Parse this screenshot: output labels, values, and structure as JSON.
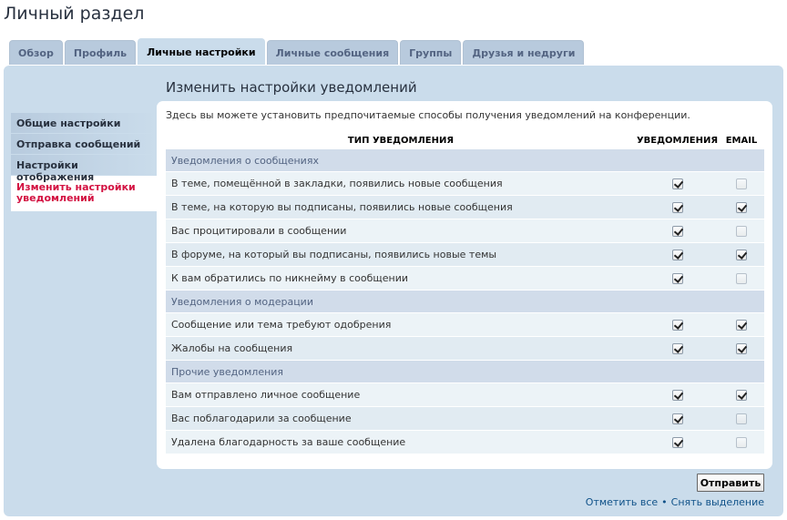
{
  "page_title": "Личный раздел",
  "tabs": [
    {
      "label": "Обзор",
      "active": false
    },
    {
      "label": "Профиль",
      "active": false
    },
    {
      "label": "Личные настройки",
      "active": true
    },
    {
      "label": "Личные сообщения",
      "active": false
    },
    {
      "label": "Группы",
      "active": false
    },
    {
      "label": "Друзья и недруги",
      "active": false
    }
  ],
  "sidebar": {
    "items": [
      {
        "label": "Общие настройки",
        "active": false
      },
      {
        "label": "Отправка сообщений",
        "active": false
      },
      {
        "label": "Настройки отображения",
        "active": false
      },
      {
        "label": "Изменить настройки уведомлений",
        "active": true
      }
    ]
  },
  "main": {
    "heading": "Изменить настройки уведомлений",
    "intro": "Здесь вы можете установить предпочитаемые способы получения уведомлений на конференции.",
    "table": {
      "headers": {
        "type": "ТИП УВЕДОМЛЕНИЯ",
        "notifications": "УВЕДОМЛЕНИЯ",
        "email": "EMAIL"
      },
      "groups": [
        {
          "title": "Уведомления о сообщениях",
          "items": [
            {
              "label": "В теме, помещённой в закладки, появились новые сообщения",
              "notif": true,
              "email": false
            },
            {
              "label": "В теме, на которую вы подписаны, появились новые сообщения",
              "notif": true,
              "email": true
            },
            {
              "label": "Вас процитировали в сообщении",
              "notif": true,
              "email": false
            },
            {
              "label": "В форуме, на который вы подписаны, появились новые темы",
              "notif": true,
              "email": true
            },
            {
              "label": "К вам обратились по никнейму в сообщении",
              "notif": true,
              "email": false
            }
          ]
        },
        {
          "title": "Уведомления о модерации",
          "items": [
            {
              "label": "Сообщение или тема требуют одобрения",
              "notif": true,
              "email": true
            },
            {
              "label": "Жалобы на сообщения",
              "notif": true,
              "email": true
            }
          ]
        },
        {
          "title": "Прочие уведомления",
          "items": [
            {
              "label": "Вам отправлено личное сообщение",
              "notif": true,
              "email": true
            },
            {
              "label": "Вас поблагодарили за сообщение",
              "notif": true,
              "email": false
            },
            {
              "label": "Удалена благодарность за ваше сообщение",
              "notif": true,
              "email": false
            }
          ]
        }
      ]
    },
    "submit_label": "Отправить",
    "mark_all": "Отметить все",
    "separator": "•",
    "unmark_all": "Снять выделение"
  }
}
